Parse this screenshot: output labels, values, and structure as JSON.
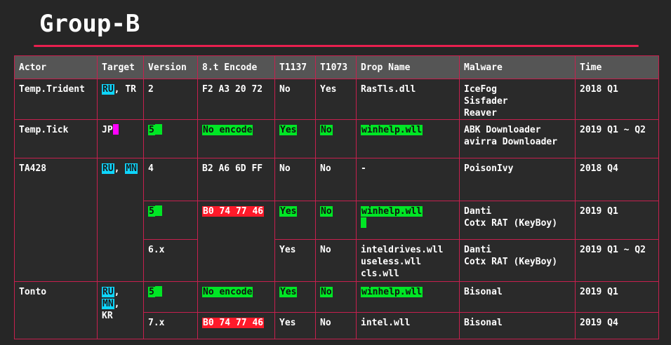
{
  "title": "Group-B",
  "colors": {
    "accent_rule": "#e8204f",
    "grid_border": "#c6204e",
    "header_bg": "#555555",
    "highlight_cyan": "#0ed6ff",
    "highlight_magenta": "#ff00ff",
    "highlight_green": "#00e625",
    "highlight_red": "#ff1a2a"
  },
  "table": {
    "headers": [
      "Actor",
      "Target",
      "Version",
      "8.t Encode",
      "T1137",
      "T1073",
      "Drop Name",
      "Malware",
      "Time"
    ],
    "rows": [
      {
        "actor": "Temp.Trident",
        "target_1": "RU",
        "target_sep": ", ",
        "target_2": "TR",
        "version": "2",
        "encode": "F2 A3 20 72",
        "t1137": "No",
        "t1073": "Yes",
        "drop": [
          "RasTls.dll"
        ],
        "malware": [
          "IceFog",
          "Sisfader",
          "Reaver"
        ],
        "time": "2018 Q1"
      },
      {
        "actor": "Temp.Tick",
        "target_1": "JP",
        "version": "5",
        "encode": "No encode",
        "t1137": "Yes",
        "t1073": "No",
        "drop": [
          "winhelp.wll"
        ],
        "malware": [
          "ABK Downloader",
          "avirra Downloader"
        ],
        "time": "2019 Q1 ~ Q2"
      },
      {
        "actor": "TA428",
        "target_1": "RU",
        "target_sep": ", ",
        "target_2": "MN",
        "version": "4",
        "encode": "B2 A6 6D FF",
        "t1137": "No",
        "t1073": "No",
        "drop": [
          "-"
        ],
        "malware": [
          "PoisonIvy"
        ],
        "time": "2018 Q4"
      },
      {
        "version": "5",
        "encode": "B0 74 77 46",
        "t1137": "Yes",
        "t1073": "No",
        "drop": [
          "winhelp.wll"
        ],
        "malware": [
          "Danti",
          "Cotx RAT (KeyBoy)"
        ],
        "time": "2019 Q1"
      },
      {
        "version": "6.x",
        "t1137": "Yes",
        "t1073": "No",
        "drop": [
          "inteldrives.wll",
          "useless.wll",
          "cls.wll"
        ],
        "malware": [
          "Danti",
          "Cotx RAT (KeyBoy)"
        ],
        "time": "2019 Q1 ~ Q2"
      },
      {
        "actor": "Tonto",
        "target_1": "RU",
        "target_sep": ", ",
        "target_2": "MN",
        "target_sep2": ",",
        "target_3": "KR",
        "version": "5",
        "encode": "No encode",
        "t1137": "Yes",
        "t1073": "No",
        "drop": [
          "winhelp.wll"
        ],
        "malware": [
          "Bisonal"
        ],
        "time": "2019 Q1"
      },
      {
        "version": "7.x",
        "encode": "B0 74 77 46",
        "t1137": "Yes",
        "t1073": "No",
        "drop": [
          "intel.wll"
        ],
        "malware": [
          "Bisonal"
        ],
        "time": "2019 Q4"
      }
    ]
  }
}
